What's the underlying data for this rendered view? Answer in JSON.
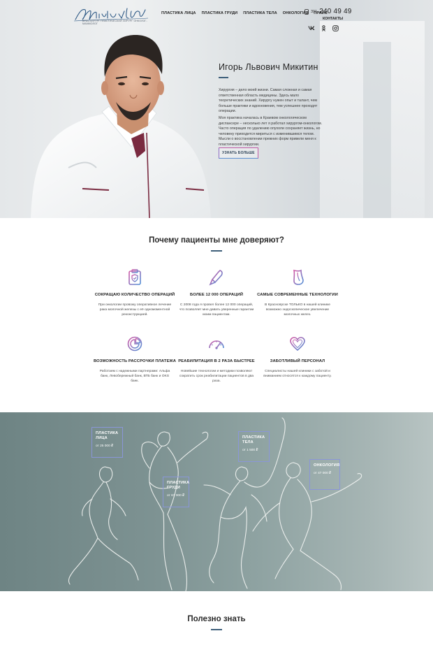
{
  "header": {
    "logo_subtitle": "ВРАЧ-ХИРУРГ ПЛАСТИЧЕСКИЙ ХИРУРГ ОНКОЛОГ-МАММОЛОГ",
    "nav": [
      "ПЛАСТИКА ЛИЦА",
      "ПЛАСТИКА ГРУДИ",
      "ПЛАСТИКА ТЕЛА",
      "ОНКОЛОГИЯ",
      "ПРАЙС"
    ],
    "phone_code": "391",
    "phone_number": "240 49 49",
    "contacts_label": "КОНТАКТЫ",
    "socials": [
      "vk-icon",
      "ok-icon",
      "instagram-icon"
    ]
  },
  "hero": {
    "name": "Игорь Львович Микитин",
    "paragraph_1": "Хирургия – дело моей жизни. Самая сложная и самая ответственная область медицины. Здесь мало теоретических знаний. Хирургу нужен опыт и талант, чем больше практики и вдохновения, тем успешнее проходят операции.",
    "paragraph_2": "Моя практика началась в Краевом онкологическом диспансере – несколько лет я работал хирургом-онкологом. Часто операция по удалению опухоли сохраняет жизнь, но человеку приходится мириться с изменившимся телом. Мысли о восстановлении прежних форм привели меня к пластической хирургии.",
    "button": "УЗНАТЬ БОЛЬШЕ"
  },
  "why": {
    "title": "Почему пациенты мне доверяют?",
    "features": [
      {
        "icon": "clipboard-shield-icon",
        "title": "СОКРАЩАЮ КОЛИЧЕСТВО ОПЕРАЦИЙ",
        "text": "При онкологии провожу оперативное лечение рака молочной железы с её одномоментной реконструкцией."
      },
      {
        "icon": "scalpel-icon",
        "title": "БОЛЕЕ 12 000 ОПЕРАЦИЙ",
        "text": "С 2008 года я провел более 12 000 операций, что позволяет мне давать уверенные гарантии моим пациентам."
      },
      {
        "icon": "implant-icon",
        "title": "САМЫЕ СОВРЕМЕННЫЕ ТЕХНОЛОГИИ",
        "text": "В Красноярске ТОЛЬКО в нашей клинике возможно эндоскопическое увеличение молочных желез."
      },
      {
        "icon": "pie-chart-icon",
        "title": "ВОЗМОЖНОСТЬ РАССРОЧКИ ПЛАТЕЖА",
        "text": "Работаем с надежными партнерами: Альфа банк, Левобережный банк, ВТБ банк и OKS банк."
      },
      {
        "icon": "speedometer-icon",
        "title": "РЕАБИЛИТАЦИЯ В 2 РАЗА БЫСТРЕЕ",
        "text": "Новейшие технологии и методики позволяют сократить срок реабилитации пациентов в два раза."
      },
      {
        "icon": "heart-icon",
        "title": "ЗАБОТЛИВЫЙ ПЕРСОНАЛ",
        "text": "Специалисты нашей клиники с заботой и вниманием относятся к каждому пациенту."
      }
    ]
  },
  "services": [
    {
      "title_1": "ПЛАСТИКА",
      "title_2": "ЛИЦА",
      "price": "от 25 000 ₽"
    },
    {
      "title_1": "ПЛАСТИКА",
      "title_2": "ГРУДИ",
      "price": "от 67 000 ₽"
    },
    {
      "title_1": "ПЛАСТИКА",
      "title_2": "ТЕЛА",
      "price": "от 1 500 ₽"
    },
    {
      "title_1": "ОНКОЛОГИЯ",
      "title_2": "",
      "price": "от 47 000 ₽"
    }
  ],
  "useful": {
    "title": "Полезно знать"
  },
  "colors": {
    "accent_blue": "#3e5f7a",
    "icon_gradient_start": "#d15aa6",
    "icon_gradient_end": "#4f8fd6",
    "sketch_bg": "#7d9292"
  }
}
